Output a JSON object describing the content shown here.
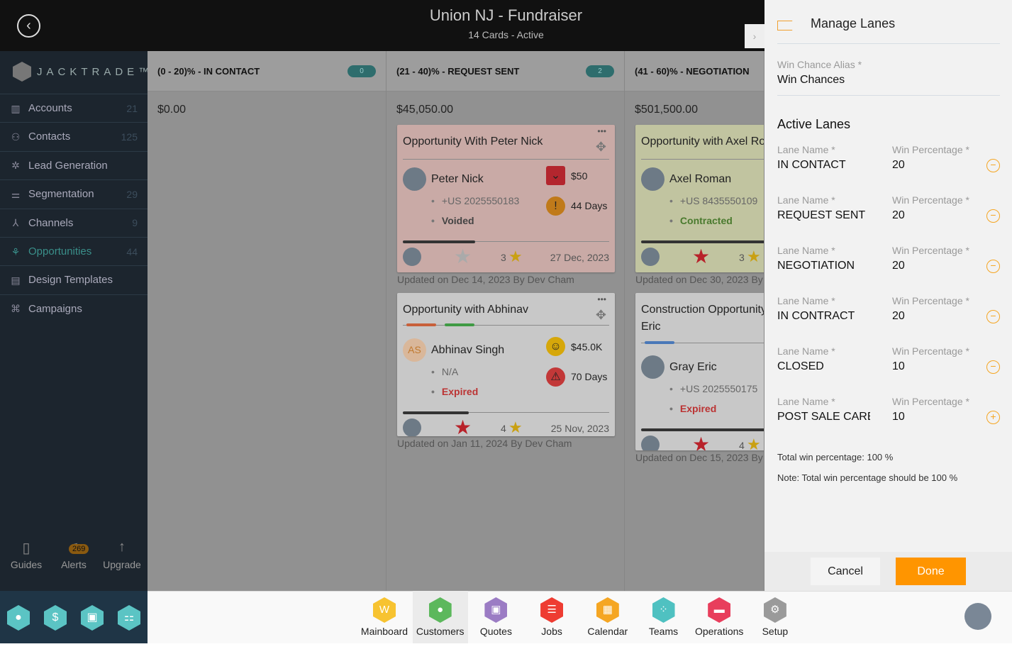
{
  "header": {
    "title": "Union NJ - Fundraiser",
    "subtitle": "14 Cards - Active"
  },
  "sidebar": {
    "brand": "JACKTRADE™",
    "items": [
      {
        "label": "Accounts",
        "count": "21",
        "icon": "building-icon"
      },
      {
        "label": "Contacts",
        "count": "125",
        "icon": "contacts-icon"
      },
      {
        "label": "Lead Generation",
        "count": "",
        "icon": "lead-icon"
      },
      {
        "label": "Segmentation",
        "count": "29",
        "icon": "segmentation-icon"
      },
      {
        "label": "Channels",
        "count": "9",
        "icon": "channels-icon"
      },
      {
        "label": "Opportunities",
        "count": "44",
        "icon": "opportunities-icon",
        "active": true
      },
      {
        "label": "Design Templates",
        "count": "",
        "icon": "templates-icon"
      },
      {
        "label": "Campaigns",
        "count": "",
        "icon": "campaigns-icon"
      }
    ],
    "tools": [
      {
        "label": "Guides"
      },
      {
        "label": "Alerts",
        "badge": "269"
      },
      {
        "label": "Upgrade"
      }
    ]
  },
  "board": {
    "columns": [
      {
        "title": "(0 - 20)% - IN CONTACT",
        "count": "0",
        "amount": "$0.00",
        "cards": []
      },
      {
        "title": "(21 - 40)% - REQUEST SENT",
        "count": "2",
        "amount": "$45,050.00",
        "cards": [
          {
            "title": "Opportunity With Peter Nick",
            "contact": "Peter Nick",
            "phone": "+US 2025550183",
            "status": "Voided",
            "value": "$50",
            "days": "44 Days",
            "rating": "3",
            "date": "27 Dec, 2023",
            "updated": "Updated on Dec 14, 2023 By Dev Cham",
            "progress": 0.35
          },
          {
            "title": "Opportunity with Abhinav",
            "contact": "Abhinav Singh",
            "initials": "AS",
            "phone": "N/A",
            "status": "Expired",
            "value": "$45.0K",
            "days": "70 Days",
            "rating": "4",
            "date": "25 Nov, 2023",
            "updated": "Updated on Jan 11, 2024 By Dev Cham",
            "progress": 0.32
          }
        ]
      },
      {
        "title": "(41 - 60)% - NEGOTIATION",
        "amount": "$501,500.00",
        "cards": [
          {
            "title": "Opportunity with Axel Ro",
            "contact": "Axel Roman",
            "phone": "+US 8435550109",
            "status": "Contracted",
            "rating": "3",
            "updated": "Updated on Dec 30, 2023 By D"
          },
          {
            "title": "Construction Opportunity",
            "title2": "Eric",
            "contact": "Gray Eric",
            "phone": "+US 2025550175",
            "status": "Expired",
            "rating": "4",
            "updated": "Updated on Dec 15, 2023 By D"
          }
        ]
      }
    ]
  },
  "panel": {
    "title": "Manage Lanes",
    "alias_label": "Win Chance Alias *",
    "alias_value": "Win Chances",
    "active_lanes": "Active Lanes",
    "lane_label": "Lane Name *",
    "pct_label": "Win Percentage *",
    "lanes": [
      {
        "name": "IN CONTACT",
        "pct": "20"
      },
      {
        "name": "REQUEST SENT",
        "pct": "20"
      },
      {
        "name": "NEGOTIATION",
        "pct": "20"
      },
      {
        "name": "IN CONTRACT",
        "pct": "20"
      },
      {
        "name": "CLOSED",
        "pct": "10"
      },
      {
        "name": "POST SALE CARE",
        "pct": "10"
      }
    ],
    "total": "Total win percentage: 100 %",
    "note": "Note: Total win percentage should be 100 %",
    "cancel": "Cancel",
    "done": "Done",
    "accent": "#ff9500"
  },
  "bottom_nav": [
    {
      "label": "Mainboard",
      "color": "#f7c331"
    },
    {
      "label": "Customers",
      "color": "#5cb85c",
      "selected": true
    },
    {
      "label": "Quotes",
      "color": "#9b7cc4"
    },
    {
      "label": "Jobs",
      "color": "#ee3c32"
    },
    {
      "label": "Calendar",
      "color": "#f5a623"
    },
    {
      "label": "Teams",
      "color": "#4fc1c1"
    },
    {
      "label": "Operations",
      "color": "#e83e5c"
    },
    {
      "label": "Setup",
      "color": "#9a9a9a"
    }
  ]
}
